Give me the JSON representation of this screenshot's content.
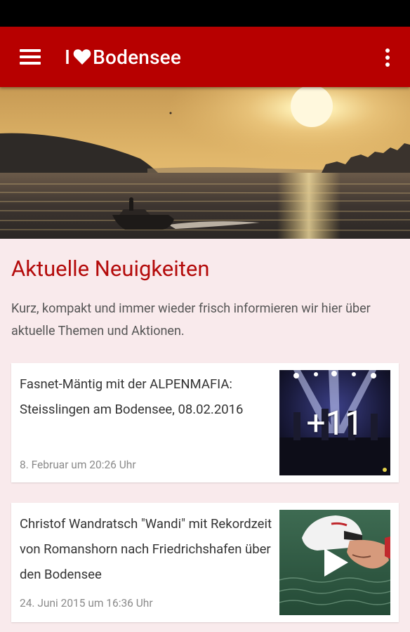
{
  "app": {
    "title_prefix": "I",
    "title_suffix": "Bodensee"
  },
  "colors": {
    "app_bar": "#b70000",
    "accent_title": "#b40b0b",
    "page_background": "#f9eaec"
  },
  "icons": {
    "menu": "hamburger-menu-icon",
    "heart": "heart-icon",
    "overflow": "overflow-menu-icon",
    "play": "play-icon"
  },
  "section": {
    "title": "Aktuelle Neuigkeiten",
    "description": "Kurz, kompakt und immer wieder frisch informieren wir hier über aktuelle Themen und Aktionen."
  },
  "news": [
    {
      "title": "Fasnet-Mäntig mit der ALPENMAFIA: Steisslingen am Bodensee, 08.02.2016",
      "date": "8. Februar um 20:26 Uhr",
      "overlay": "+11"
    },
    {
      "title": "Christof Wandratsch \"Wandi\" mit Rekordzeit von Romanshorn nach Friedrichshafen über den Bodensee",
      "date": "24. Juni 2015 um 16:36 Uhr"
    }
  ]
}
